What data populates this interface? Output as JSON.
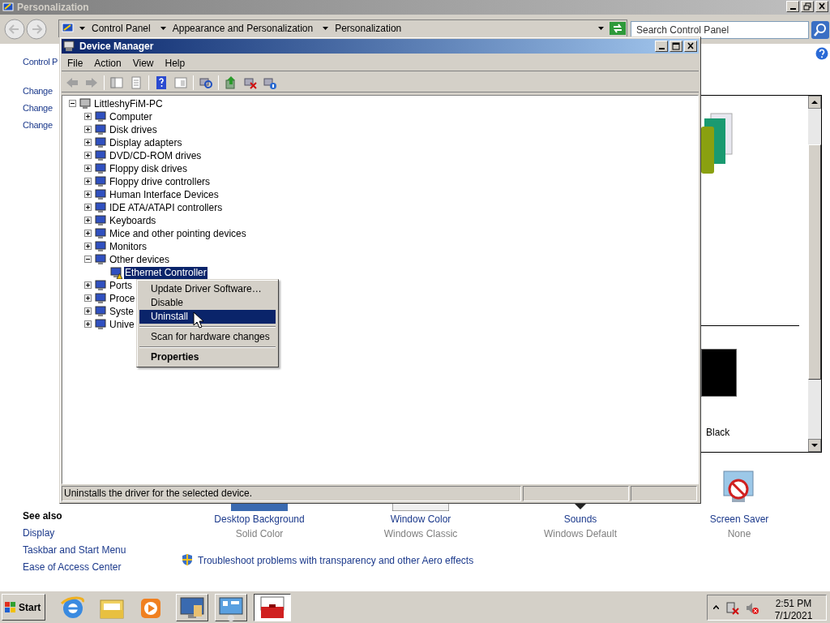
{
  "personalization_window": {
    "title": "Personalization",
    "breadcrumb": [
      "Control Panel",
      "Appearance and Personalization",
      "Personalization"
    ],
    "search": {
      "placeholder": "Search Control Panel"
    },
    "left_links": [
      "Control P",
      "Change",
      "Change",
      "Change"
    ],
    "see_also": {
      "heading": "See also",
      "links": [
        "Display",
        "Taskbar and Start Menu",
        "Ease of Access Center"
      ]
    },
    "theme_label": "Black",
    "settings": [
      {
        "label": "Desktop Background",
        "value": "Solid Color"
      },
      {
        "label": "Window Color",
        "value": "Windows Classic"
      },
      {
        "label": "Sounds",
        "value": "Windows Default"
      },
      {
        "label": "Screen Saver",
        "value": "None"
      }
    ],
    "troubleshoot_link": "Troubleshoot problems with transparency and other Aero effects"
  },
  "device_manager": {
    "title": "Device Manager",
    "menu": [
      "File",
      "Action",
      "View",
      "Help"
    ],
    "tree": {
      "label": "LittleshyFiM-PC",
      "expanded": true,
      "selected": false,
      "children": [
        {
          "label": "Computer",
          "expanded": false,
          "selected": false
        },
        {
          "label": "Disk drives",
          "expanded": false,
          "selected": false
        },
        {
          "label": "Display adapters",
          "expanded": false,
          "selected": false
        },
        {
          "label": "DVD/CD-ROM drives",
          "expanded": false,
          "selected": false
        },
        {
          "label": "Floppy disk drives",
          "expanded": false,
          "selected": false
        },
        {
          "label": "Floppy drive controllers",
          "expanded": false,
          "selected": false
        },
        {
          "label": "Human Interface Devices",
          "expanded": false,
          "selected": false
        },
        {
          "label": "IDE ATA/ATAPI controllers",
          "expanded": false,
          "selected": false
        },
        {
          "label": "Keyboards",
          "expanded": false,
          "selected": false
        },
        {
          "label": "Mice and other pointing devices",
          "expanded": false,
          "selected": false
        },
        {
          "label": "Monitors",
          "expanded": false,
          "selected": false
        },
        {
          "label": "Other devices",
          "expanded": true,
          "selected": false,
          "children": [
            {
              "label": "Ethernet Controller",
              "selected": true
            }
          ]
        },
        {
          "label": "Ports",
          "expanded": false,
          "selected": false
        },
        {
          "label": "Proce",
          "expanded": false,
          "selected": false
        },
        {
          "label": "Syste",
          "expanded": false,
          "selected": false
        },
        {
          "label": "Unive",
          "expanded": false,
          "selected": false
        }
      ]
    },
    "status_bar": "Uninstalls the driver for the selected device."
  },
  "context_menu": {
    "items": [
      {
        "kind": "item",
        "label": "Update Driver Software…",
        "selected": false
      },
      {
        "kind": "item",
        "label": "Disable",
        "selected": false
      },
      {
        "kind": "item",
        "label": "Uninstall",
        "selected": true
      },
      {
        "kind": "separator"
      },
      {
        "kind": "item",
        "label": "Scan for hardware changes",
        "selected": false
      },
      {
        "kind": "separator"
      },
      {
        "kind": "default",
        "label": "Properties",
        "selected": false
      }
    ]
  },
  "taskbar": {
    "start": "Start",
    "time": "2:51 PM",
    "date": "7/1/2021"
  }
}
